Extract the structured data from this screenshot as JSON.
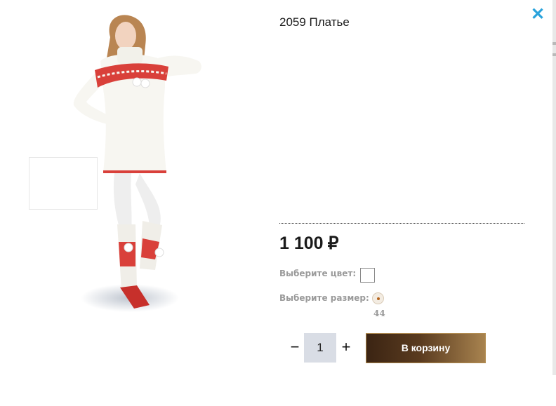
{
  "product": {
    "title": "2059 Платье",
    "price": "1 100",
    "currency": "₽"
  },
  "options": {
    "color_label": "Выберите цвет:",
    "size_label": "Выберите размер:",
    "size_value": "44"
  },
  "quantity": {
    "minus": "−",
    "value": "1",
    "plus": "+"
  },
  "cart": {
    "button_label": "В корзину"
  },
  "close": {
    "glyph": "✕"
  },
  "colors": {
    "accent": "#2aa3dc",
    "button_dark": "#3b2413",
    "button_light": "#a8834f"
  },
  "icons": {
    "close": "close-icon",
    "size_radio": "radio-icon"
  }
}
